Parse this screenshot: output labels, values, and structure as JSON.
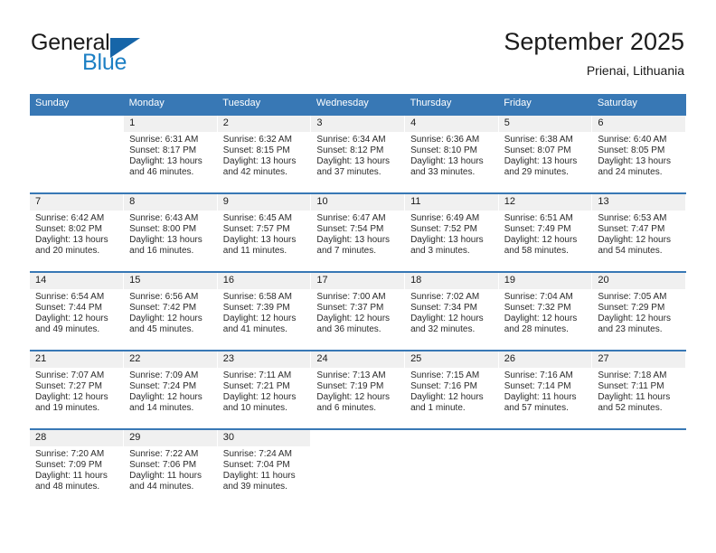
{
  "brand": {
    "name_part1": "General",
    "name_part2": "Blue",
    "triangle_color": "#1665a8",
    "blue_color": "#1c7fc4"
  },
  "header": {
    "title": "September 2025",
    "subtitle": "Prienai, Lithuania"
  },
  "theme": {
    "header_row_bg": "#3878b5",
    "daynum_bg": "#f0f0f0",
    "row_border": "#3878b5"
  },
  "weekdays": [
    "Sunday",
    "Monday",
    "Tuesday",
    "Wednesday",
    "Thursday",
    "Friday",
    "Saturday"
  ],
  "weeks": [
    [
      {
        "day": "",
        "sunrise": "",
        "sunset": "",
        "daylight": "",
        "daylight2": ""
      },
      {
        "day": "1",
        "sunrise": "Sunrise: 6:31 AM",
        "sunset": "Sunset: 8:17 PM",
        "daylight": "Daylight: 13 hours",
        "daylight2": "and 46 minutes."
      },
      {
        "day": "2",
        "sunrise": "Sunrise: 6:32 AM",
        "sunset": "Sunset: 8:15 PM",
        "daylight": "Daylight: 13 hours",
        "daylight2": "and 42 minutes."
      },
      {
        "day": "3",
        "sunrise": "Sunrise: 6:34 AM",
        "sunset": "Sunset: 8:12 PM",
        "daylight": "Daylight: 13 hours",
        "daylight2": "and 37 minutes."
      },
      {
        "day": "4",
        "sunrise": "Sunrise: 6:36 AM",
        "sunset": "Sunset: 8:10 PM",
        "daylight": "Daylight: 13 hours",
        "daylight2": "and 33 minutes."
      },
      {
        "day": "5",
        "sunrise": "Sunrise: 6:38 AM",
        "sunset": "Sunset: 8:07 PM",
        "daylight": "Daylight: 13 hours",
        "daylight2": "and 29 minutes."
      },
      {
        "day": "6",
        "sunrise": "Sunrise: 6:40 AM",
        "sunset": "Sunset: 8:05 PM",
        "daylight": "Daylight: 13 hours",
        "daylight2": "and 24 minutes."
      }
    ],
    [
      {
        "day": "7",
        "sunrise": "Sunrise: 6:42 AM",
        "sunset": "Sunset: 8:02 PM",
        "daylight": "Daylight: 13 hours",
        "daylight2": "and 20 minutes."
      },
      {
        "day": "8",
        "sunrise": "Sunrise: 6:43 AM",
        "sunset": "Sunset: 8:00 PM",
        "daylight": "Daylight: 13 hours",
        "daylight2": "and 16 minutes."
      },
      {
        "day": "9",
        "sunrise": "Sunrise: 6:45 AM",
        "sunset": "Sunset: 7:57 PM",
        "daylight": "Daylight: 13 hours",
        "daylight2": "and 11 minutes."
      },
      {
        "day": "10",
        "sunrise": "Sunrise: 6:47 AM",
        "sunset": "Sunset: 7:54 PM",
        "daylight": "Daylight: 13 hours",
        "daylight2": "and 7 minutes."
      },
      {
        "day": "11",
        "sunrise": "Sunrise: 6:49 AM",
        "sunset": "Sunset: 7:52 PM",
        "daylight": "Daylight: 13 hours",
        "daylight2": "and 3 minutes."
      },
      {
        "day": "12",
        "sunrise": "Sunrise: 6:51 AM",
        "sunset": "Sunset: 7:49 PM",
        "daylight": "Daylight: 12 hours",
        "daylight2": "and 58 minutes."
      },
      {
        "day": "13",
        "sunrise": "Sunrise: 6:53 AM",
        "sunset": "Sunset: 7:47 PM",
        "daylight": "Daylight: 12 hours",
        "daylight2": "and 54 minutes."
      }
    ],
    [
      {
        "day": "14",
        "sunrise": "Sunrise: 6:54 AM",
        "sunset": "Sunset: 7:44 PM",
        "daylight": "Daylight: 12 hours",
        "daylight2": "and 49 minutes."
      },
      {
        "day": "15",
        "sunrise": "Sunrise: 6:56 AM",
        "sunset": "Sunset: 7:42 PM",
        "daylight": "Daylight: 12 hours",
        "daylight2": "and 45 minutes."
      },
      {
        "day": "16",
        "sunrise": "Sunrise: 6:58 AM",
        "sunset": "Sunset: 7:39 PM",
        "daylight": "Daylight: 12 hours",
        "daylight2": "and 41 minutes."
      },
      {
        "day": "17",
        "sunrise": "Sunrise: 7:00 AM",
        "sunset": "Sunset: 7:37 PM",
        "daylight": "Daylight: 12 hours",
        "daylight2": "and 36 minutes."
      },
      {
        "day": "18",
        "sunrise": "Sunrise: 7:02 AM",
        "sunset": "Sunset: 7:34 PM",
        "daylight": "Daylight: 12 hours",
        "daylight2": "and 32 minutes."
      },
      {
        "day": "19",
        "sunrise": "Sunrise: 7:04 AM",
        "sunset": "Sunset: 7:32 PM",
        "daylight": "Daylight: 12 hours",
        "daylight2": "and 28 minutes."
      },
      {
        "day": "20",
        "sunrise": "Sunrise: 7:05 AM",
        "sunset": "Sunset: 7:29 PM",
        "daylight": "Daylight: 12 hours",
        "daylight2": "and 23 minutes."
      }
    ],
    [
      {
        "day": "21",
        "sunrise": "Sunrise: 7:07 AM",
        "sunset": "Sunset: 7:27 PM",
        "daylight": "Daylight: 12 hours",
        "daylight2": "and 19 minutes."
      },
      {
        "day": "22",
        "sunrise": "Sunrise: 7:09 AM",
        "sunset": "Sunset: 7:24 PM",
        "daylight": "Daylight: 12 hours",
        "daylight2": "and 14 minutes."
      },
      {
        "day": "23",
        "sunrise": "Sunrise: 7:11 AM",
        "sunset": "Sunset: 7:21 PM",
        "daylight": "Daylight: 12 hours",
        "daylight2": "and 10 minutes."
      },
      {
        "day": "24",
        "sunrise": "Sunrise: 7:13 AM",
        "sunset": "Sunset: 7:19 PM",
        "daylight": "Daylight: 12 hours",
        "daylight2": "and 6 minutes."
      },
      {
        "day": "25",
        "sunrise": "Sunrise: 7:15 AM",
        "sunset": "Sunset: 7:16 PM",
        "daylight": "Daylight: 12 hours",
        "daylight2": "and 1 minute."
      },
      {
        "day": "26",
        "sunrise": "Sunrise: 7:16 AM",
        "sunset": "Sunset: 7:14 PM",
        "daylight": "Daylight: 11 hours",
        "daylight2": "and 57 minutes."
      },
      {
        "day": "27",
        "sunrise": "Sunrise: 7:18 AM",
        "sunset": "Sunset: 7:11 PM",
        "daylight": "Daylight: 11 hours",
        "daylight2": "and 52 minutes."
      }
    ],
    [
      {
        "day": "28",
        "sunrise": "Sunrise: 7:20 AM",
        "sunset": "Sunset: 7:09 PM",
        "daylight": "Daylight: 11 hours",
        "daylight2": "and 48 minutes."
      },
      {
        "day": "29",
        "sunrise": "Sunrise: 7:22 AM",
        "sunset": "Sunset: 7:06 PM",
        "daylight": "Daylight: 11 hours",
        "daylight2": "and 44 minutes."
      },
      {
        "day": "30",
        "sunrise": "Sunrise: 7:24 AM",
        "sunset": "Sunset: 7:04 PM",
        "daylight": "Daylight: 11 hours",
        "daylight2": "and 39 minutes."
      },
      {
        "day": "",
        "sunrise": "",
        "sunset": "",
        "daylight": "",
        "daylight2": ""
      },
      {
        "day": "",
        "sunrise": "",
        "sunset": "",
        "daylight": "",
        "daylight2": ""
      },
      {
        "day": "",
        "sunrise": "",
        "sunset": "",
        "daylight": "",
        "daylight2": ""
      },
      {
        "day": "",
        "sunrise": "",
        "sunset": "",
        "daylight": "",
        "daylight2": ""
      }
    ]
  ]
}
